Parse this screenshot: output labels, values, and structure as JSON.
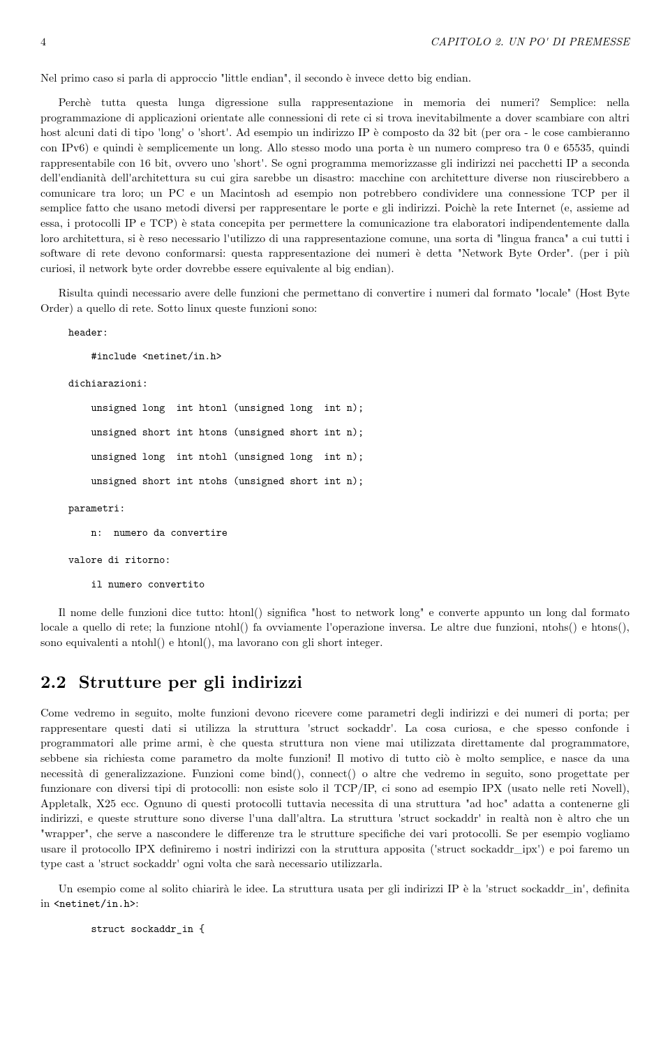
{
  "header": {
    "page": "4",
    "chapter": "CAPITOLO 2. UN PO' DI PREMESSE"
  },
  "p1": "Nel primo caso si parla di approccio \"little endian\", il secondo è invece detto big endian.",
  "p2": "Perchè tutta questa lunga digressione sulla rappresentazione in memoria dei numeri? Semplice: nella programmazione di applicazioni orientate alle connessioni di rete ci si trova inevitabilmente a dover scambiare con altri host alcuni dati di tipo 'long' o 'short'. Ad esempio un indirizzo IP è composto da 32 bit (per ora - le cose cambieranno con IPv6) e quindi è semplicemente un long. Allo stesso modo una porta è un numero compreso tra 0 e 65535, quindi rappresentabile con 16 bit, ovvero uno 'short'. Se ogni programma memorizzasse gli indirizzi nei pacchetti IP a seconda dell'endianità dell'architettura su cui gira sarebbe un disastro: macchine con architetture diverse non riuscirebbero a comunicare tra loro; un PC e un Macintosh ad esempio non potrebbero condividere una connessione TCP per il semplice fatto che usano metodi diversi per rappresentare le porte e gli indirizzi. Poichè la rete Internet (e, assieme ad essa, i protocolli IP e TCP) è stata concepita per permettere la comunicazione tra elaboratori indipendentemente dalla loro architettura, si è reso necessario l'utilizzo di una rappresentazione comune, una sorta di \"lingua franca\" a cui tutti i software di rete devono conformarsi: questa rappresentazione dei numeri è detta \"Network Byte Order\". (per i più curiosi, il network byte order dovrebbe essere equivalente al big endian).",
  "p3": "Risulta quindi necessario avere delle funzioni che permettano di convertire i numeri dal formato \"locale\" (Host Byte Order) a quello di rete. Sotto linux queste funzioni sono:",
  "code": {
    "header_label": "header:",
    "header_include": "    #include <netinet/in.h>",
    "decl_label": "dichiarazioni:",
    "decl_l1": "    unsigned long  int htonl (unsigned long  int n);",
    "decl_l2": "    unsigned short int htons (unsigned short int n);",
    "decl_l3": "    unsigned long  int ntohl (unsigned long  int n);",
    "decl_l4": "    unsigned short int ntohs (unsigned short int n);",
    "param_label": "parametri:",
    "param_l1": "    n:  numero da convertire",
    "return_label": "valore di ritorno:",
    "return_l1": "    il numero convertito"
  },
  "p4": "Il nome delle funzioni dice tutto: htonl() significa \"host to network long\" e converte appunto un long dal formato locale a quello di rete; la funzione ntohl() fa ovviamente l'operazione inversa. Le altre due funzioni, ntohs() e htons(), sono equivalenti a ntohl() e htonl(), ma lavorano con gli short integer.",
  "section": {
    "num": "2.2",
    "title": "Strutture per gli indirizzi"
  },
  "p5": "Come vedremo in seguito, molte funzioni devono ricevere come parametri degli indirizzi e dei numeri di porta; per rappresentare questi dati si utilizza la struttura 'struct sockaddr'. La cosa curiosa, e che spesso confonde i programmatori alle prime armi, è che questa struttura non viene mai utilizzata direttamente dal programmatore, sebbene sia richiesta come parametro da molte funzioni! Il motivo di tutto ciò è molto semplice, e nasce da una necessità di generalizzazione. Funzioni come bind(), connect() o altre che vedremo in seguito, sono progettate per funzionare con diversi tipi di protocolli: non esiste solo il TCP/IP, ci sono ad esempio IPX (usato nelle reti Novell), Appletalk, X25 ecc. Ognuno di questi protocolli tuttavia necessita di una struttura \"ad hoc\" adatta a contenerne gli indirizzi, e queste strutture sono diverse l'una dall'altra. La struttura 'struct sockaddr' in realtà non è altro che un \"wrapper\", che serve a nascondere le differenze tra le strutture specifiche dei vari protocolli. Se per esempio vogliamo usare il protocollo IPX definiremo i nostri indirizzi con la struttura apposita ('struct sockaddr_ipx') e poi faremo un type cast a 'struct sockaddr' ogni volta che sarà necessario utilizzarla.",
  "p6a": "Un esempio come al solito chiarirà le idee.  La struttura usata per gli indirizzi IP è la 'struct sockaddr_in', definita in ",
  "p6b": "<netinet/in.h>",
  "p6c": ":",
  "code2": "    struct sockaddr_in {"
}
